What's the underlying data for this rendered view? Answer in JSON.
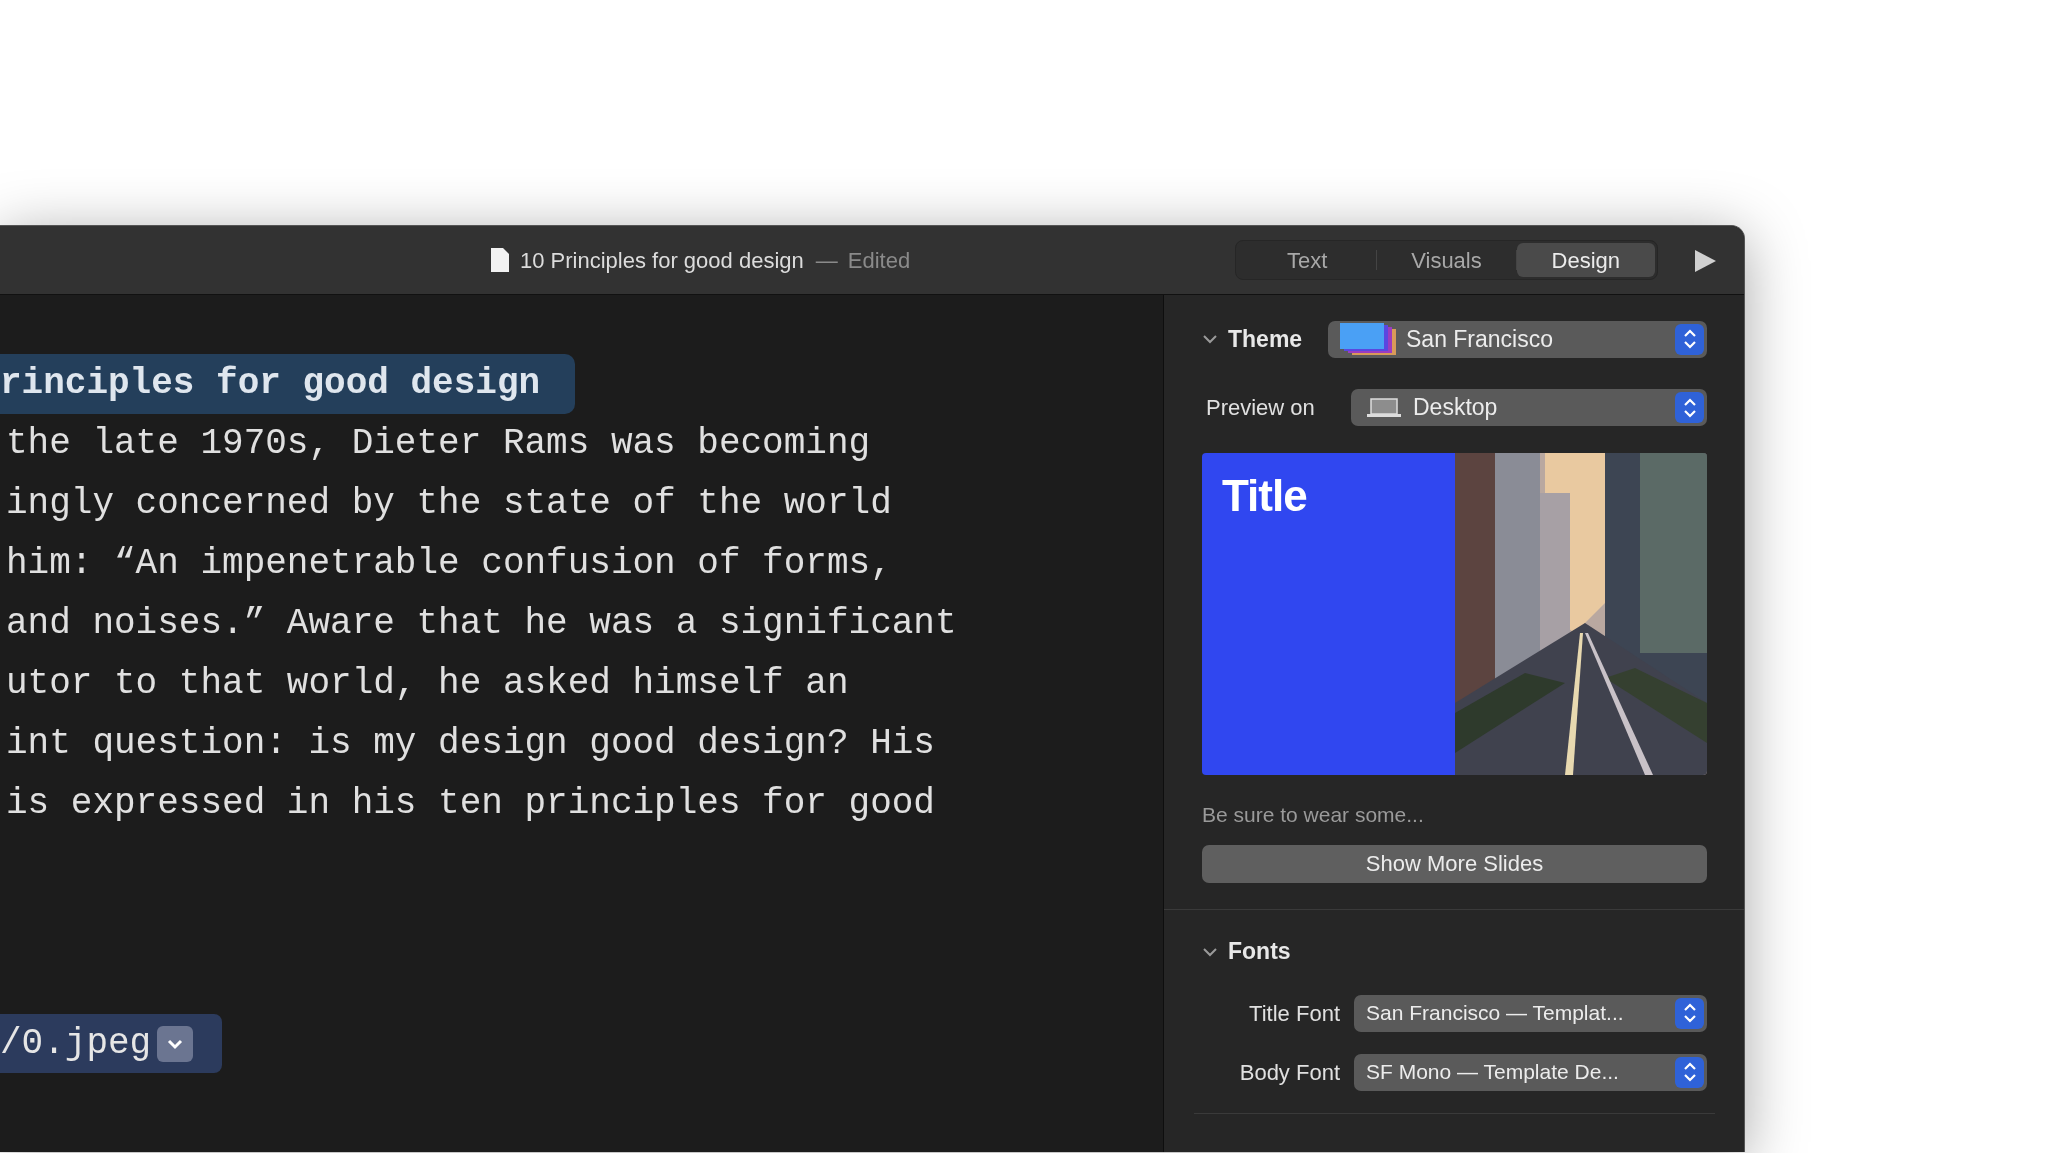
{
  "window": {
    "title": "10 Principles for good design",
    "separator": "—",
    "status": "Edited"
  },
  "tabs": [
    {
      "label": "Text",
      "selected": false
    },
    {
      "label": "Visuals",
      "selected": false
    },
    {
      "label": "Design",
      "selected": true
    }
  ],
  "editor": {
    "heading": "rinciples for good design",
    "lines": [
      "the late 1970s, Dieter Rams was becoming",
      "ingly concerned by the state of the world",
      "him: “An impenetrable confusion of forms,",
      "and noises.” Aware that he was a significant",
      "utor to that world, he asked himself an",
      "int question: is my design good design? His",
      "is expressed in his ten principles for good"
    ],
    "image_chip": "/0.jpeg"
  },
  "inspector": {
    "theme": {
      "label": "Theme",
      "expanded": true,
      "value": "San Francisco"
    },
    "preview_on": {
      "label": "Preview on",
      "value": "Desktop"
    },
    "slide_preview": {
      "title": "Title",
      "caption": "Be sure to wear some..."
    },
    "show_more_button": "Show More Slides",
    "fonts": {
      "label": "Fonts",
      "expanded": true,
      "rows": [
        {
          "label": "Title Font",
          "value": "San Francisco — Templat..."
        },
        {
          "label": "Body Font",
          "value": "SF Mono — Template De..."
        }
      ]
    }
  }
}
